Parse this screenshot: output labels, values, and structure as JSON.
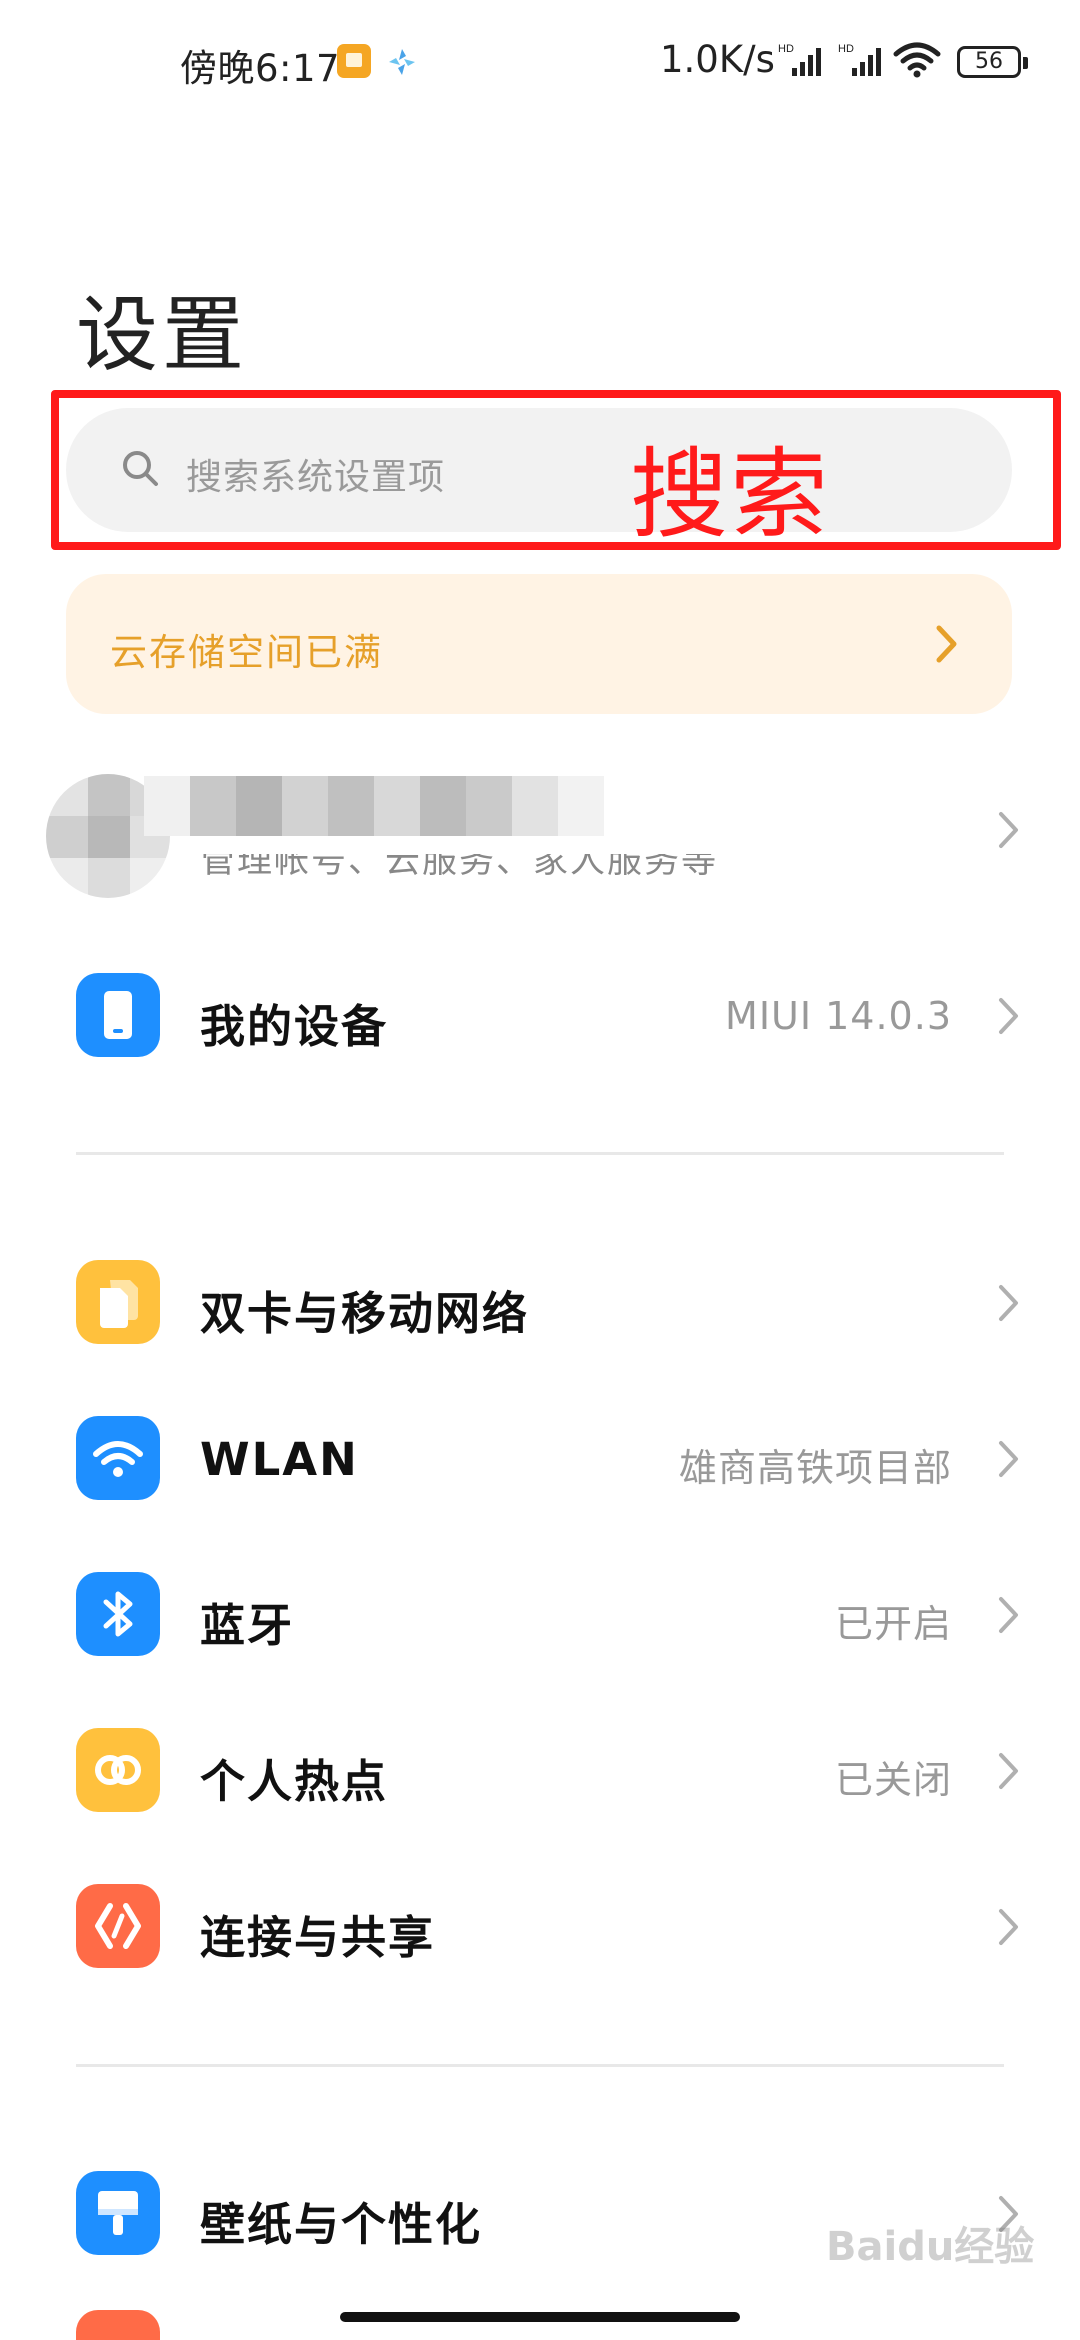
{
  "status_bar": {
    "time": "傍晚6:17",
    "net_speed": "1.0K/s",
    "battery": "56",
    "signal_tag": "HD"
  },
  "page": {
    "title": "设置"
  },
  "search": {
    "placeholder": "搜索系统设置项",
    "annotation_label": "搜索"
  },
  "cloud_banner": {
    "text": "云存储空间已满"
  },
  "account": {
    "subtitle": "管理帐号、云服务、家人服务等"
  },
  "sections": [
    [
      {
        "icon": "phone-icon",
        "label": "我的设备",
        "value": "MIUI 14.0.3",
        "color": "#1e8fff"
      }
    ],
    [
      {
        "icon": "sim-card-icon",
        "label": "双卡与移动网络",
        "value": "",
        "color": "#ffc13d"
      },
      {
        "icon": "wifi-icon",
        "label": "WLAN",
        "value": "雄商高铁项目部",
        "color": "#1e8fff"
      },
      {
        "icon": "bluetooth-icon",
        "label": "蓝牙",
        "value": "已开启",
        "color": "#1e8fff"
      },
      {
        "icon": "hotspot-icon",
        "label": "个人热点",
        "value": "已关闭",
        "color": "#ffc13d"
      },
      {
        "icon": "share-icon",
        "label": "连接与共享",
        "value": "",
        "color": "#ff6b47"
      }
    ],
    [
      {
        "icon": "wallpaper-icon",
        "label": "壁纸与个性化",
        "value": "",
        "color": "#1e8fff"
      }
    ]
  ],
  "watermark": "Baidu经验"
}
